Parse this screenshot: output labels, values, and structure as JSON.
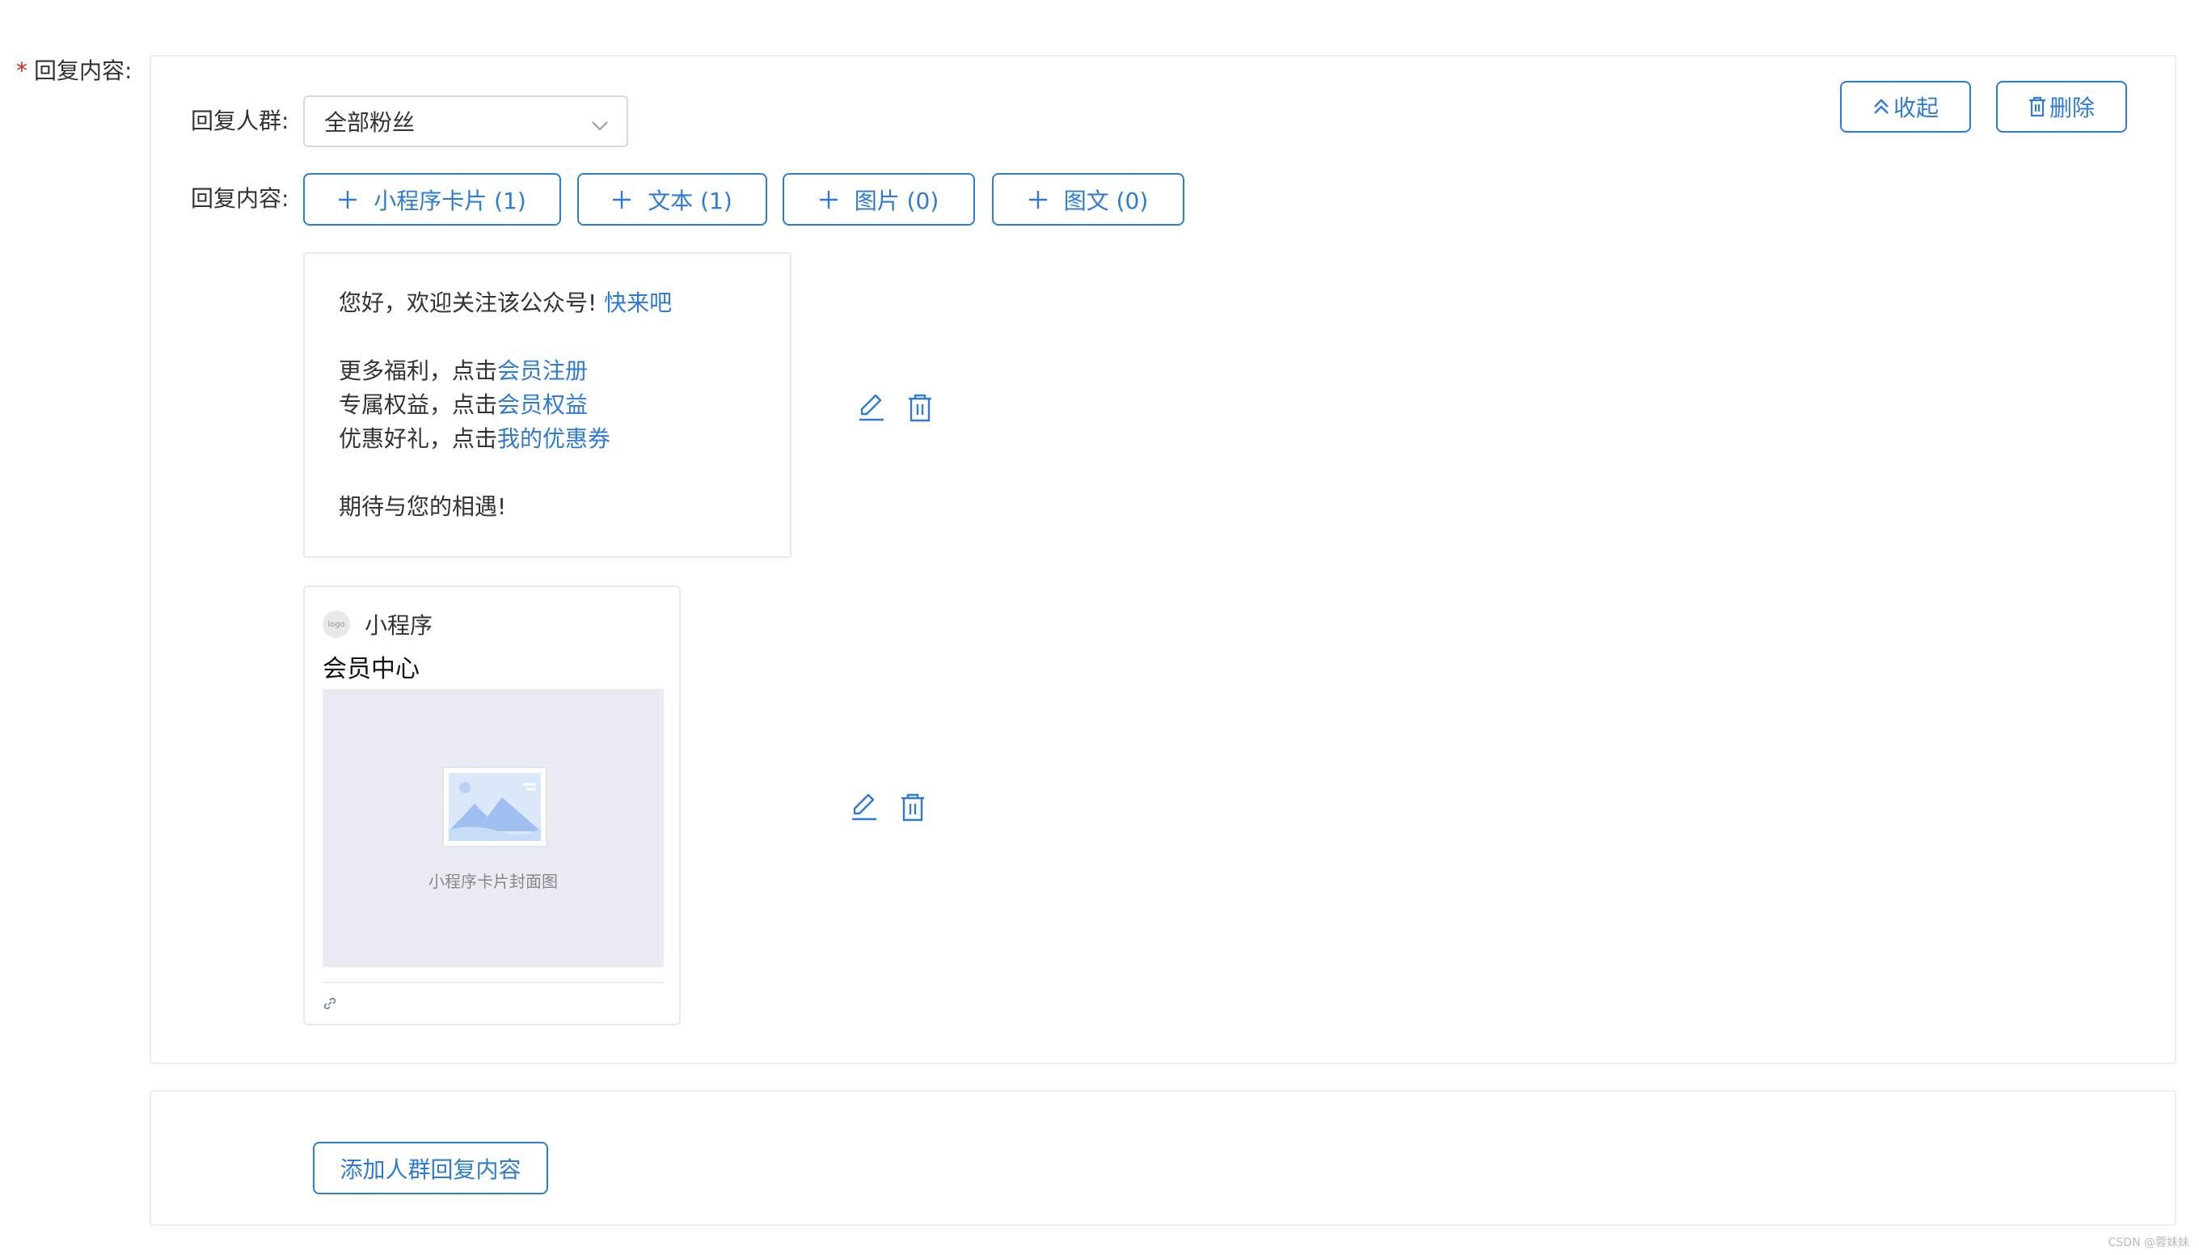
{
  "form": {
    "required_mark": "*",
    "label": "回复内容:"
  },
  "panel": {
    "audience_label": "回复人群:",
    "audience_value": "全部粉丝",
    "content_label": "回复内容:",
    "collapse_label": "收起",
    "delete_label": "删除",
    "add_buttons": [
      {
        "label": "小程序卡片 (1)"
      },
      {
        "label": "文本 (1)"
      },
      {
        "label": "图片 (0)"
      },
      {
        "label": "图文 (0)"
      }
    ]
  },
  "text_message": {
    "line1": "您好，欢迎关注该公众号! ",
    "line1_link": "快来吧",
    "line2": "更多福利，点击",
    "line2_link": "会员注册",
    "line3": "专属权益，点击",
    "line3_link": "会员权益",
    "line4": "优惠好礼，点击",
    "line4_link": "我的优惠券",
    "line5": "期待与您的相遇!"
  },
  "mini_program_card": {
    "logo_text": "logo",
    "app_label": "小程序",
    "title": "会员中心",
    "cover_caption": "小程序卡片封面图"
  },
  "footer": {
    "add_group_label": "添加人群回复内容"
  },
  "watermark": "CSDN @蓉妹妹",
  "colors": {
    "accent": "#2f7bd4",
    "required": "#e02020",
    "border": "#ebeef5",
    "cover_bg": "#e9ecf3"
  }
}
